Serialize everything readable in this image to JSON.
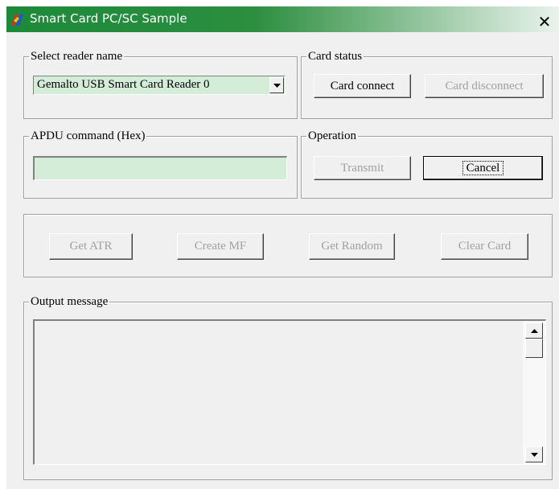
{
  "window": {
    "title": "Smart Card PC/SC Sample"
  },
  "reader_group": {
    "label": "Select reader name",
    "selected_reader": "Gemalto USB Smart Card Reader 0"
  },
  "card_status": {
    "label": "Card status",
    "connect": "Card connect",
    "disconnect": "Card disconnect"
  },
  "apdu": {
    "label": "APDU command (Hex)",
    "value": ""
  },
  "operation": {
    "label": "Operation",
    "transmit": "Transmit",
    "cancel": "Cancel"
  },
  "actions": {
    "get_atr": "Get ATR",
    "create_mf": "Create MF",
    "get_random": "Get Random",
    "clear_card": "Clear Card"
  },
  "output": {
    "label": "Output message",
    "text": ""
  },
  "colors": {
    "title_start": "#1c8a3a",
    "title_end": "#e9f3ec",
    "field_bg": "#d4edd8",
    "face": "#f0f0f0"
  },
  "icons": {
    "app": "smart-card-app-icon",
    "close": "close-icon"
  }
}
